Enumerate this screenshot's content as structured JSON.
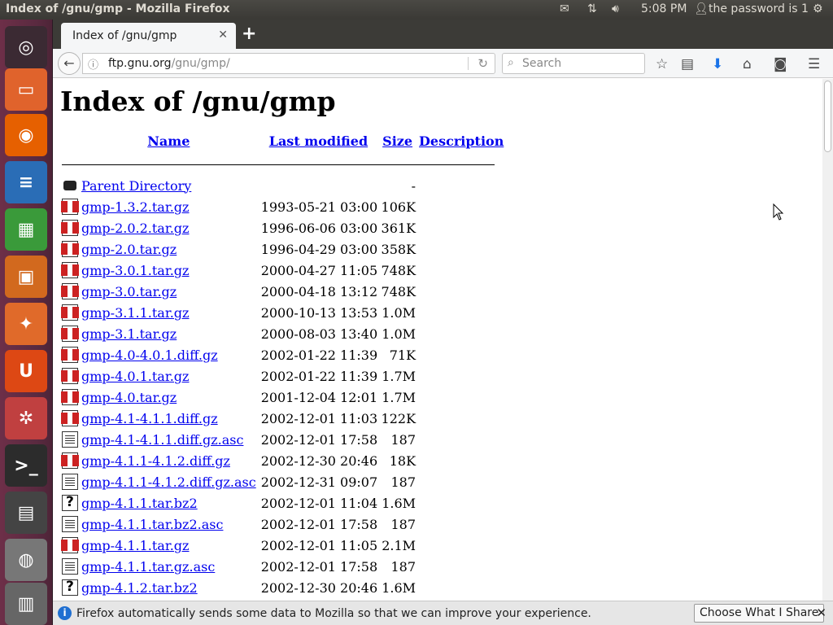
{
  "top_panel": {
    "window_title": "Index of /gnu/gmp - Mozilla Firefox",
    "time": "5:08 PM",
    "user_text": "the password is 1",
    "icons": [
      "mail-icon",
      "network-icon",
      "volume-icon",
      "user-icon",
      "gear-icon"
    ]
  },
  "launcher": {
    "items": [
      {
        "name": "ubuntu-dash",
        "glyph": "◎",
        "color": "#3b2a33"
      },
      {
        "name": "files",
        "glyph": "▭",
        "color": "#e0632c"
      },
      {
        "name": "firefox",
        "glyph": "◉",
        "color": "#e66000"
      },
      {
        "name": "libreoffice-writer",
        "glyph": "≡",
        "color": "#2a6db6"
      },
      {
        "name": "libreoffice-calc",
        "glyph": "▦",
        "color": "#3a9a3a"
      },
      {
        "name": "libreoffice-impress",
        "glyph": "▣",
        "color": "#d2691e"
      },
      {
        "name": "software-center",
        "glyph": "✦",
        "color": "#e06a2a"
      },
      {
        "name": "ubuntu-one",
        "glyph": "U",
        "color": "#dd4814"
      },
      {
        "name": "system-settings",
        "glyph": "✲",
        "color": "#c04040"
      },
      {
        "name": "terminal",
        "glyph": ">_",
        "color": "#2c2c2c"
      },
      {
        "name": "workspace-switcher",
        "glyph": "▤",
        "color": "#444444"
      },
      {
        "name": "dvd",
        "glyph": "◍",
        "color": "#777777"
      },
      {
        "name": "trash",
        "glyph": "▥",
        "color": "#666666"
      }
    ]
  },
  "browser": {
    "tab_title": "Index of /gnu/gmp",
    "url_host": "ftp.gnu.org",
    "url_path": "/gnu/gmp/",
    "search_placeholder": "Search"
  },
  "page": {
    "heading": "Index of /gnu/gmp",
    "columns": {
      "name": "Name",
      "modified": "Last modified",
      "size": "Size",
      "description": "Description"
    },
    "parent": {
      "name": "Parent Directory",
      "size": "-"
    },
    "rows": [
      {
        "icon": "comp",
        "name": "gmp-1.3.2.tar.gz",
        "modified": "1993-05-21 03:00",
        "size": "106K"
      },
      {
        "icon": "comp",
        "name": "gmp-2.0.2.tar.gz",
        "modified": "1996-06-06 03:00",
        "size": "361K"
      },
      {
        "icon": "comp",
        "name": "gmp-2.0.tar.gz",
        "modified": "1996-04-29 03:00",
        "size": "358K"
      },
      {
        "icon": "comp",
        "name": "gmp-3.0.1.tar.gz",
        "modified": "2000-04-27 11:05",
        "size": "748K"
      },
      {
        "icon": "comp",
        "name": "gmp-3.0.tar.gz",
        "modified": "2000-04-18 13:12",
        "size": "748K"
      },
      {
        "icon": "comp",
        "name": "gmp-3.1.1.tar.gz",
        "modified": "2000-10-13 13:53",
        "size": "1.0M"
      },
      {
        "icon": "comp",
        "name": "gmp-3.1.tar.gz",
        "modified": "2000-08-03 13:40",
        "size": "1.0M"
      },
      {
        "icon": "comp",
        "name": "gmp-4.0-4.0.1.diff.gz",
        "modified": "2002-01-22 11:39",
        "size": "71K"
      },
      {
        "icon": "comp",
        "name": "gmp-4.0.1.tar.gz",
        "modified": "2002-01-22 11:39",
        "size": "1.7M"
      },
      {
        "icon": "comp",
        "name": "gmp-4.0.tar.gz",
        "modified": "2001-12-04 12:01",
        "size": "1.7M"
      },
      {
        "icon": "comp",
        "name": "gmp-4.1-4.1.1.diff.gz",
        "modified": "2002-12-01 11:03",
        "size": "122K"
      },
      {
        "icon": "txt",
        "name": "gmp-4.1-4.1.1.diff.gz.asc",
        "modified": "2002-12-01 17:58",
        "size": "187"
      },
      {
        "icon": "comp",
        "name": "gmp-4.1.1-4.1.2.diff.gz",
        "modified": "2002-12-30 20:46",
        "size": "18K"
      },
      {
        "icon": "txt",
        "name": "gmp-4.1.1-4.1.2.diff.gz.asc",
        "modified": "2002-12-31 09:07",
        "size": "187"
      },
      {
        "icon": "unk",
        "name": "gmp-4.1.1.tar.bz2",
        "modified": "2002-12-01 11:04",
        "size": "1.6M"
      },
      {
        "icon": "txt",
        "name": "gmp-4.1.1.tar.bz2.asc",
        "modified": "2002-12-01 17:58",
        "size": "187"
      },
      {
        "icon": "comp",
        "name": "gmp-4.1.1.tar.gz",
        "modified": "2002-12-01 11:05",
        "size": "2.1M"
      },
      {
        "icon": "txt",
        "name": "gmp-4.1.1.tar.gz.asc",
        "modified": "2002-12-01 17:58",
        "size": "187"
      },
      {
        "icon": "unk",
        "name": "gmp-4.1.2.tar.bz2",
        "modified": "2002-12-30 20:46",
        "size": "1.6M"
      }
    ]
  },
  "notification": {
    "text": "Firefox automatically sends some data to Mozilla so that we can improve your experience.",
    "button": "Choose What I Share"
  }
}
